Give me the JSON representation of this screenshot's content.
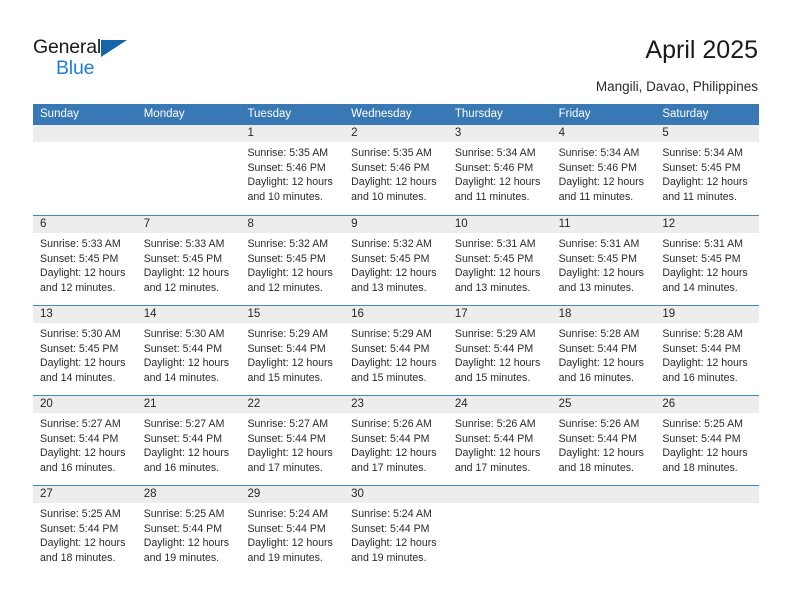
{
  "brand": {
    "name_top": "General",
    "name_bottom": "Blue",
    "triangle_color": "#1565ab",
    "blue_color": "#1e7fd4"
  },
  "header": {
    "title": "April 2025",
    "location": "Mangili, Davao, Philippines"
  },
  "theme": {
    "header_bar": "#3878b4",
    "daynum_strip": "#ededed",
    "row_divider": "#4a86bf",
    "text": "#2b2b2b"
  },
  "weekdays": [
    "Sunday",
    "Monday",
    "Tuesday",
    "Wednesday",
    "Thursday",
    "Friday",
    "Saturday"
  ],
  "weeks": [
    [
      {
        "day": "",
        "lines": []
      },
      {
        "day": "",
        "lines": []
      },
      {
        "day": "1",
        "lines": [
          "Sunrise: 5:35 AM",
          "Sunset: 5:46 PM",
          "Daylight: 12 hours",
          "and 10 minutes."
        ]
      },
      {
        "day": "2",
        "lines": [
          "Sunrise: 5:35 AM",
          "Sunset: 5:46 PM",
          "Daylight: 12 hours",
          "and 10 minutes."
        ]
      },
      {
        "day": "3",
        "lines": [
          "Sunrise: 5:34 AM",
          "Sunset: 5:46 PM",
          "Daylight: 12 hours",
          "and 11 minutes."
        ]
      },
      {
        "day": "4",
        "lines": [
          "Sunrise: 5:34 AM",
          "Sunset: 5:46 PM",
          "Daylight: 12 hours",
          "and 11 minutes."
        ]
      },
      {
        "day": "5",
        "lines": [
          "Sunrise: 5:34 AM",
          "Sunset: 5:45 PM",
          "Daylight: 12 hours",
          "and 11 minutes."
        ]
      }
    ],
    [
      {
        "day": "6",
        "lines": [
          "Sunrise: 5:33 AM",
          "Sunset: 5:45 PM",
          "Daylight: 12 hours",
          "and 12 minutes."
        ]
      },
      {
        "day": "7",
        "lines": [
          "Sunrise: 5:33 AM",
          "Sunset: 5:45 PM",
          "Daylight: 12 hours",
          "and 12 minutes."
        ]
      },
      {
        "day": "8",
        "lines": [
          "Sunrise: 5:32 AM",
          "Sunset: 5:45 PM",
          "Daylight: 12 hours",
          "and 12 minutes."
        ]
      },
      {
        "day": "9",
        "lines": [
          "Sunrise: 5:32 AM",
          "Sunset: 5:45 PM",
          "Daylight: 12 hours",
          "and 13 minutes."
        ]
      },
      {
        "day": "10",
        "lines": [
          "Sunrise: 5:31 AM",
          "Sunset: 5:45 PM",
          "Daylight: 12 hours",
          "and 13 minutes."
        ]
      },
      {
        "day": "11",
        "lines": [
          "Sunrise: 5:31 AM",
          "Sunset: 5:45 PM",
          "Daylight: 12 hours",
          "and 13 minutes."
        ]
      },
      {
        "day": "12",
        "lines": [
          "Sunrise: 5:31 AM",
          "Sunset: 5:45 PM",
          "Daylight: 12 hours",
          "and 14 minutes."
        ]
      }
    ],
    [
      {
        "day": "13",
        "lines": [
          "Sunrise: 5:30 AM",
          "Sunset: 5:45 PM",
          "Daylight: 12 hours",
          "and 14 minutes."
        ]
      },
      {
        "day": "14",
        "lines": [
          "Sunrise: 5:30 AM",
          "Sunset: 5:44 PM",
          "Daylight: 12 hours",
          "and 14 minutes."
        ]
      },
      {
        "day": "15",
        "lines": [
          "Sunrise: 5:29 AM",
          "Sunset: 5:44 PM",
          "Daylight: 12 hours",
          "and 15 minutes."
        ]
      },
      {
        "day": "16",
        "lines": [
          "Sunrise: 5:29 AM",
          "Sunset: 5:44 PM",
          "Daylight: 12 hours",
          "and 15 minutes."
        ]
      },
      {
        "day": "17",
        "lines": [
          "Sunrise: 5:29 AM",
          "Sunset: 5:44 PM",
          "Daylight: 12 hours",
          "and 15 minutes."
        ]
      },
      {
        "day": "18",
        "lines": [
          "Sunrise: 5:28 AM",
          "Sunset: 5:44 PM",
          "Daylight: 12 hours",
          "and 16 minutes."
        ]
      },
      {
        "day": "19",
        "lines": [
          "Sunrise: 5:28 AM",
          "Sunset: 5:44 PM",
          "Daylight: 12 hours",
          "and 16 minutes."
        ]
      }
    ],
    [
      {
        "day": "20",
        "lines": [
          "Sunrise: 5:27 AM",
          "Sunset: 5:44 PM",
          "Daylight: 12 hours",
          "and 16 minutes."
        ]
      },
      {
        "day": "21",
        "lines": [
          "Sunrise: 5:27 AM",
          "Sunset: 5:44 PM",
          "Daylight: 12 hours",
          "and 16 minutes."
        ]
      },
      {
        "day": "22",
        "lines": [
          "Sunrise: 5:27 AM",
          "Sunset: 5:44 PM",
          "Daylight: 12 hours",
          "and 17 minutes."
        ]
      },
      {
        "day": "23",
        "lines": [
          "Sunrise: 5:26 AM",
          "Sunset: 5:44 PM",
          "Daylight: 12 hours",
          "and 17 minutes."
        ]
      },
      {
        "day": "24",
        "lines": [
          "Sunrise: 5:26 AM",
          "Sunset: 5:44 PM",
          "Daylight: 12 hours",
          "and 17 minutes."
        ]
      },
      {
        "day": "25",
        "lines": [
          "Sunrise: 5:26 AM",
          "Sunset: 5:44 PM",
          "Daylight: 12 hours",
          "and 18 minutes."
        ]
      },
      {
        "day": "26",
        "lines": [
          "Sunrise: 5:25 AM",
          "Sunset: 5:44 PM",
          "Daylight: 12 hours",
          "and 18 minutes."
        ]
      }
    ],
    [
      {
        "day": "27",
        "lines": [
          "Sunrise: 5:25 AM",
          "Sunset: 5:44 PM",
          "Daylight: 12 hours",
          "and 18 minutes."
        ]
      },
      {
        "day": "28",
        "lines": [
          "Sunrise: 5:25 AM",
          "Sunset: 5:44 PM",
          "Daylight: 12 hours",
          "and 19 minutes."
        ]
      },
      {
        "day": "29",
        "lines": [
          "Sunrise: 5:24 AM",
          "Sunset: 5:44 PM",
          "Daylight: 12 hours",
          "and 19 minutes."
        ]
      },
      {
        "day": "30",
        "lines": [
          "Sunrise: 5:24 AM",
          "Sunset: 5:44 PM",
          "Daylight: 12 hours",
          "and 19 minutes."
        ]
      },
      {
        "day": "",
        "lines": []
      },
      {
        "day": "",
        "lines": []
      },
      {
        "day": "",
        "lines": []
      }
    ]
  ]
}
